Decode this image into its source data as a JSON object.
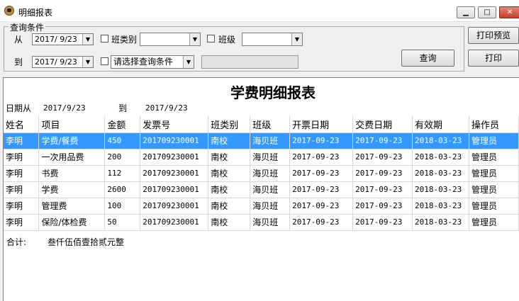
{
  "window": {
    "title": "明细报表",
    "minimize": "▁",
    "maximize": "□",
    "close": "✕"
  },
  "query": {
    "group_label": "查询条件",
    "from_label": "从",
    "to_label": "到",
    "from_date": "2017/ 9/23",
    "to_date": "2017/ 9/23",
    "class_type_label": "班类别",
    "class_type_value": "",
    "class_label": "班级",
    "class_value": "",
    "condition_value": "请选择查询条件",
    "condition_input": "",
    "query_button": "查询",
    "preview_button": "打印预览",
    "print_button": "打印"
  },
  "report": {
    "title": "学费明细报表",
    "date_from_label": "日期从",
    "date_from": "2017/9/23",
    "date_to_label": "到",
    "date_to": "2017/9/23",
    "columns": [
      "姓名",
      "项目",
      "金额",
      "发票号",
      "班类别",
      "班级",
      "开票日期",
      "交费日期",
      "有效期",
      "操作员"
    ],
    "rows": [
      [
        "李明",
        "学费/餐费",
        "450",
        "201709230001",
        "南校",
        "海贝班",
        "2017-09-23",
        "2017-09-23",
        "2018-03-23",
        "管理员"
      ],
      [
        "李明",
        "一次用品费",
        "200",
        "201709230001",
        "南校",
        "海贝班",
        "2017-09-23",
        "2017-09-23",
        "2018-03-23",
        "管理员"
      ],
      [
        "李明",
        "书费",
        "112",
        "201709230001",
        "南校",
        "海贝班",
        "2017-09-23",
        "2017-09-23",
        "2018-03-23",
        "管理员"
      ],
      [
        "李明",
        "学费",
        "2600",
        "201709230001",
        "南校",
        "海贝班",
        "2017-09-23",
        "2017-09-23",
        "2018-03-23",
        "管理员"
      ],
      [
        "李明",
        "管理费",
        "100",
        "201709230001",
        "南校",
        "海贝班",
        "2017-09-23",
        "2017-09-23",
        "2018-03-23",
        "管理员"
      ],
      [
        "李明",
        "保险/体检费",
        "50",
        "201709230001",
        "南校",
        "海贝班",
        "2017-09-23",
        "2017-09-23",
        "2018-03-23",
        "管理员"
      ]
    ],
    "selected_row": 0,
    "total_label": "合计:",
    "total_amount": "叁仟伍佰壹拾贰元整"
  },
  "colors": {
    "selection": "#3399ff",
    "background": "#f0f0f0"
  }
}
